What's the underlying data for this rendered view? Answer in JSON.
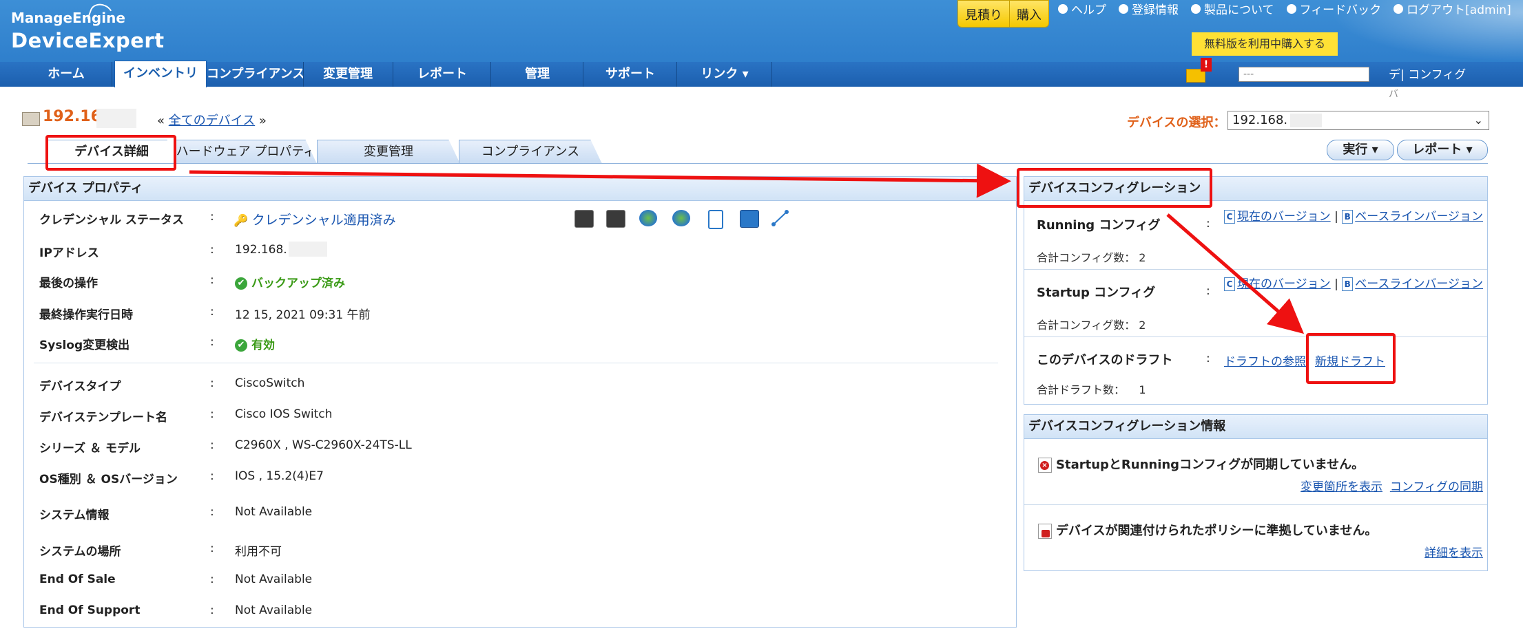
{
  "header": {
    "logo_top": "ManageEngine",
    "logo_main": "DeviceExpert",
    "quote": "見積り",
    "buy": "購入",
    "links": [
      "ヘルプ",
      "登録情報",
      "製品について",
      "フィードバック",
      "ログアウト[admin]"
    ],
    "trial": "無料版を利用中購入する"
  },
  "nav": {
    "items": [
      "ホーム",
      "インベントリ",
      "コンプライアンス",
      "変更管理",
      "レポート",
      "管理",
      "サポート",
      "リンク ▾"
    ],
    "search_placeholder": "---",
    "device_label": "デ| コンフィグ",
    "device_label2": "バ"
  },
  "device": {
    "ip": "192.168",
    "all_devices": "全てのデバイス",
    "select_label": "デバイスの選択：",
    "select_value": "192.168."
  },
  "tabs": [
    "デバイス詳細",
    "ハードウェア プロパティ",
    "変更管理",
    "コンプライアンス"
  ],
  "actions": {
    "run": "実行 ▾",
    "report": "レポート ▾"
  },
  "properties": {
    "title": "デバイス プロパティ",
    "rows": [
      {
        "label": "クレデンシャル ステータス",
        "value": "クレデンシャル適用済み"
      },
      {
        "label": "IPアドレス",
        "value": "192.168."
      },
      {
        "label": "最後の操作",
        "value": "バックアップ済み"
      },
      {
        "label": "最終操作実行日時",
        "value": "12 15, 2021 09:31 午前"
      },
      {
        "label": "Syslog変更検出",
        "value": "有効"
      },
      {
        "label": "デバイスタイプ",
        "value": "CiscoSwitch"
      },
      {
        "label": "デバイステンプレート名",
        "value": "Cisco IOS Switch"
      },
      {
        "label": "シリーズ ＆ モデル",
        "value": "C2960X , WS-C2960X-24TS-LL"
      },
      {
        "label": "OS種別 ＆ OSバージョン",
        "value": "IOS , 15.2(4)E7"
      },
      {
        "label": "システム情報",
        "value": "Not Available"
      },
      {
        "label": "システムの場所",
        "value": "利用不可"
      },
      {
        "label": "End Of Sale",
        "value": "Not Available"
      },
      {
        "label": "End Of Support",
        "value": "Not Available"
      }
    ]
  },
  "config": {
    "title": "デバイスコンフィグレーション",
    "running_label": "Running コンフィグ",
    "startup_label": "Startup コンフィグ",
    "current_version": "現在のバージョン",
    "baseline_version": "ベースラインバージョン",
    "total_configs": "合計コンフィグ数：",
    "running_count": "2",
    "startup_count": "2",
    "draft_label": "このデバイスのドラフト",
    "draft_ref": "ドラフトの参照",
    "new_draft": "新規ドラフト",
    "total_drafts": "合計ドラフト数：",
    "draft_count": "1"
  },
  "config_info": {
    "title": "デバイスコンフィグレーション情報",
    "msg1": "StartupとRunningコンフィグが同期していません。",
    "show_changes": "変更箇所を表示",
    "sync": "コンフィグの同期",
    "msg2": "デバイスが関連付けられたポリシーに準拠していません。",
    "details": "詳細を表示"
  },
  "colors": {
    "accent": "#e0611a",
    "header": "#2f7fcc",
    "annotation": "#ee1111",
    "ok": "#3a9a16"
  }
}
